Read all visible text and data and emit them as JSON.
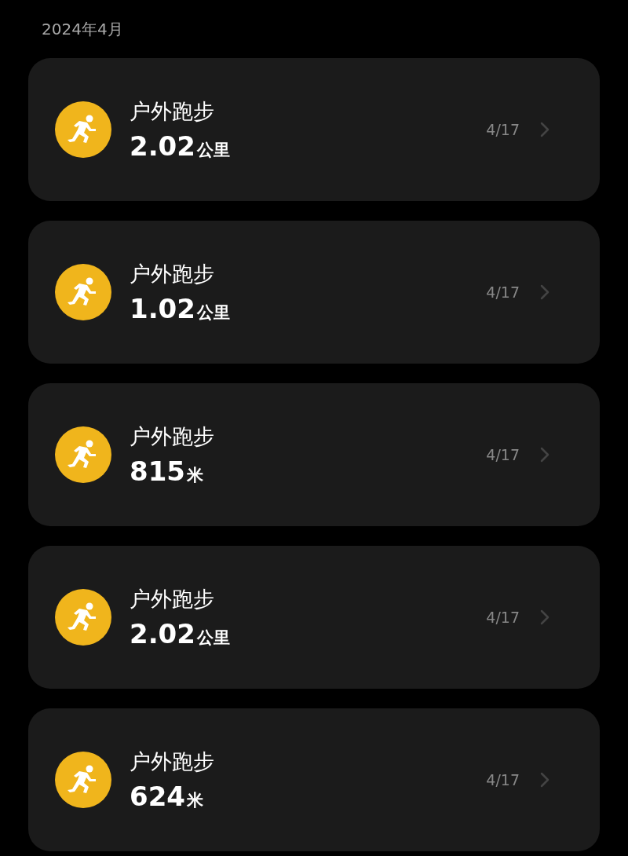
{
  "month_header": "2024年4月",
  "records": [
    {
      "title": "户外跑步",
      "value": "2.02",
      "unit": "公里",
      "date": "4/17"
    },
    {
      "title": "户外跑步",
      "value": "1.02",
      "unit": "公里",
      "date": "4/17"
    },
    {
      "title": "户外跑步",
      "value": "815",
      "unit": "米",
      "date": "4/17"
    },
    {
      "title": "户外跑步",
      "value": "2.02",
      "unit": "公里",
      "date": "4/17"
    },
    {
      "title": "户外跑步",
      "value": "624",
      "unit": "米",
      "date": "4/17"
    }
  ]
}
